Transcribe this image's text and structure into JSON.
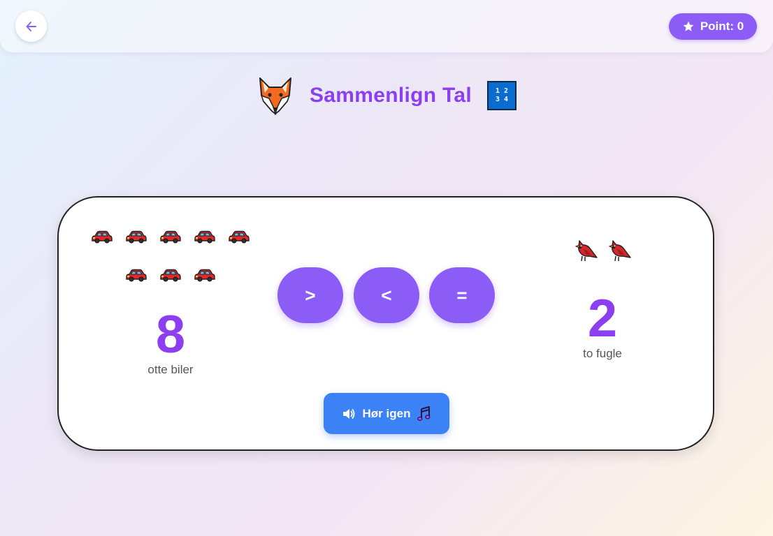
{
  "header": {
    "back_icon": "arrow-left-icon",
    "points_label": "Point: 0",
    "points_icon": "star-icon"
  },
  "title": {
    "text": "Sammenlign Tal",
    "left_icon": "fox-icon",
    "right_icon": "input-numbers-icon",
    "numbers_icon_row1": "1 2",
    "numbers_icon_row2": "3 4"
  },
  "left": {
    "number": "8",
    "label": "otte biler",
    "icon": "car-icon",
    "count": 8
  },
  "right": {
    "number": "2",
    "label": "to fugle",
    "icon": "bird-icon",
    "count": 2
  },
  "buttons": {
    "greater": ">",
    "less": "<",
    "equal": "="
  },
  "listen": {
    "label": "Hør igen",
    "icon": "speaker-icon",
    "trailing_icon": "music-notes-icon"
  },
  "colors": {
    "accent": "#8b5cf6",
    "title": "#8b3ff0",
    "listen": "#3b82f6"
  }
}
